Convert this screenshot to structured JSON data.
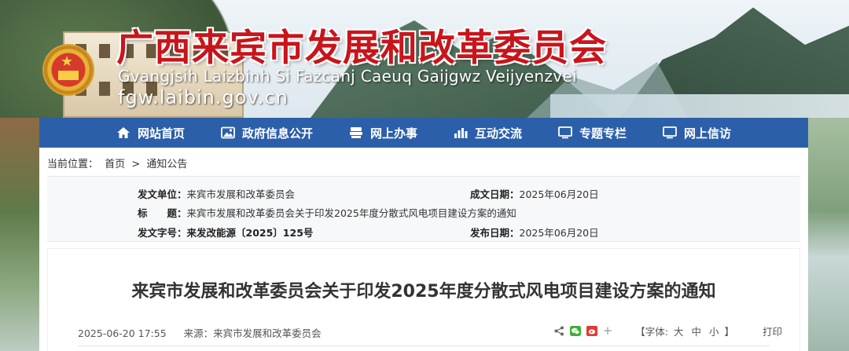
{
  "header": {
    "title": "广西来宾市发展和改革委员会",
    "zhuang_title": "Gvangjsih Laizbinh Si Fazcanj Caeuq Gaijgwz Veijyenzvei",
    "domain": "fgw.laibin.gov.cn"
  },
  "nav": [
    {
      "label": "网站首页",
      "icon": "home-icon"
    },
    {
      "label": "政府信息公开",
      "icon": "image-icon"
    },
    {
      "label": "网上办事",
      "icon": "service-icon"
    },
    {
      "label": "互动交流",
      "icon": "chart-bars-icon"
    },
    {
      "label": "专题专栏",
      "icon": "monitor-icon"
    },
    {
      "label": "网上信访",
      "icon": "monitor-icon"
    }
  ],
  "breadcrumb": {
    "prefix": "当前位置：",
    "home": "首页",
    "separator": ">",
    "current": "通知公告"
  },
  "meta": {
    "issuer_label": "发文单位：",
    "issuer": "来宾市发展和改革委员会",
    "created_label": "成文日期：",
    "created": "2025年06月20日",
    "title_label": "标　　题：",
    "title": "来宾市发展和改革委员会关于印发2025年度分散式风电项目建设方案的通知",
    "doc_no_label": "发文字号：",
    "doc_no": "来发改能源〔2025〕125号",
    "published_label": "发布日期：",
    "published": "2025年06月20日"
  },
  "article": {
    "title": "来宾市发展和改革委员会关于印发2025年度分散式风电项目建设方案的通知",
    "datetime": "2025-06-20 17:55",
    "source": "来源：来宾市发展和改革委员会",
    "font_prefix": "【字体:",
    "font_large": "大",
    "font_medium": "中",
    "font_small": "小",
    "font_suffix": "】",
    "print": "打印"
  },
  "colors": {
    "nav_bg": "#2c5faa",
    "title_red": "#c8151b"
  }
}
